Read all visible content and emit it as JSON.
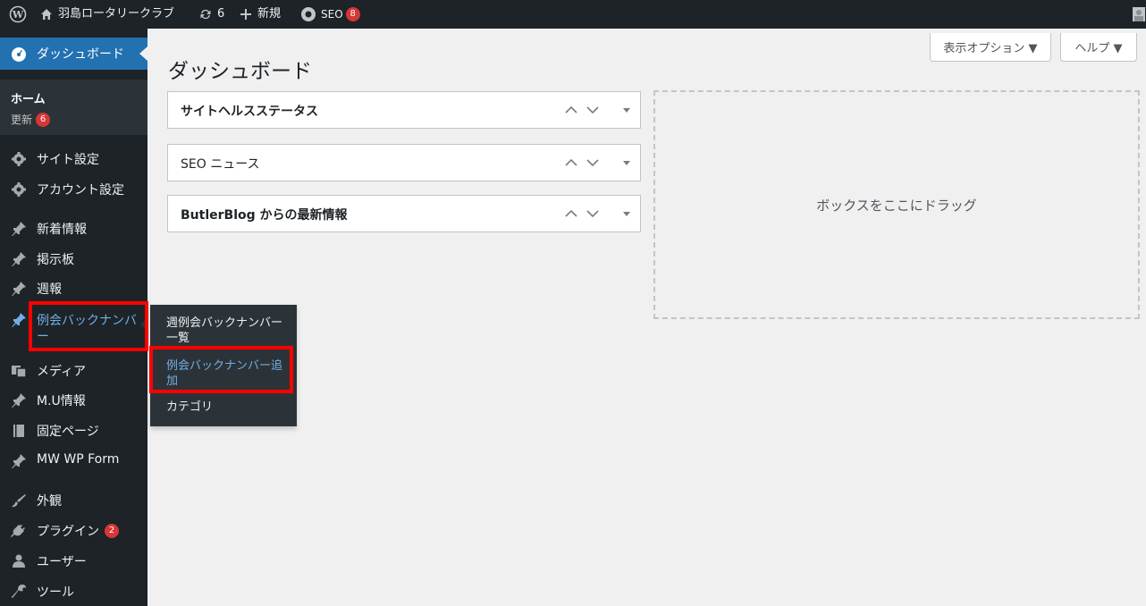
{
  "adminbar": {
    "site_name": "羽島ロータリークラブ",
    "updates_count": "6",
    "new_label": "新規",
    "seo_label": "SEO",
    "seo_badge": "8"
  },
  "sidebar": {
    "dashboard": "ダッシュボード",
    "home": "ホーム",
    "updates": "更新",
    "updates_badge": "6",
    "items": [
      {
        "label": "サイト設定",
        "icon": "gear-icon"
      },
      {
        "label": "アカウント設定",
        "icon": "gear-icon"
      },
      {
        "label": "新着情報",
        "icon": "pin-icon"
      },
      {
        "label": "掲示板",
        "icon": "pin-icon"
      },
      {
        "label": "週報",
        "icon": "pin-icon"
      },
      {
        "label": "例会バックナンバ",
        "label2": "ー",
        "icon": "pin-icon"
      },
      {
        "label": "メディア",
        "icon": "media-icon"
      },
      {
        "label": "M.U情報",
        "icon": "pin-icon"
      },
      {
        "label": "固定ページ",
        "icon": "page-icon"
      },
      {
        "label": "MW WP Form",
        "icon": "pin-icon"
      },
      {
        "label": "外観",
        "icon": "brush-icon"
      },
      {
        "label": "プラグイン",
        "icon": "plugin-icon",
        "badge": "2"
      },
      {
        "label": "ユーザー",
        "icon": "user-icon"
      },
      {
        "label": "ツール",
        "icon": "wrench-icon"
      }
    ]
  },
  "flyout": {
    "items": [
      {
        "line1": "週例会バックナンバー",
        "line2": "一覧"
      },
      {
        "line1": "例会バックナンバー追",
        "line2": "加"
      },
      {
        "line1": "カテゴリ",
        "line2": ""
      }
    ]
  },
  "main": {
    "title": "ダッシュボード",
    "screen_options": "表示オプション ▼",
    "help": "ヘルプ ▼",
    "boxes": [
      "サイトヘルスステータス",
      "SEO ニュース",
      "ButlerBlog からの最新情報"
    ],
    "dropzone": "ボックスをここにドラッグ"
  },
  "colors": {
    "sidebar_bg": "#1d2327",
    "accent": "#2271b1",
    "badge": "#d63638",
    "highlight": "#ff0000",
    "link_current": "#72aee6"
  }
}
